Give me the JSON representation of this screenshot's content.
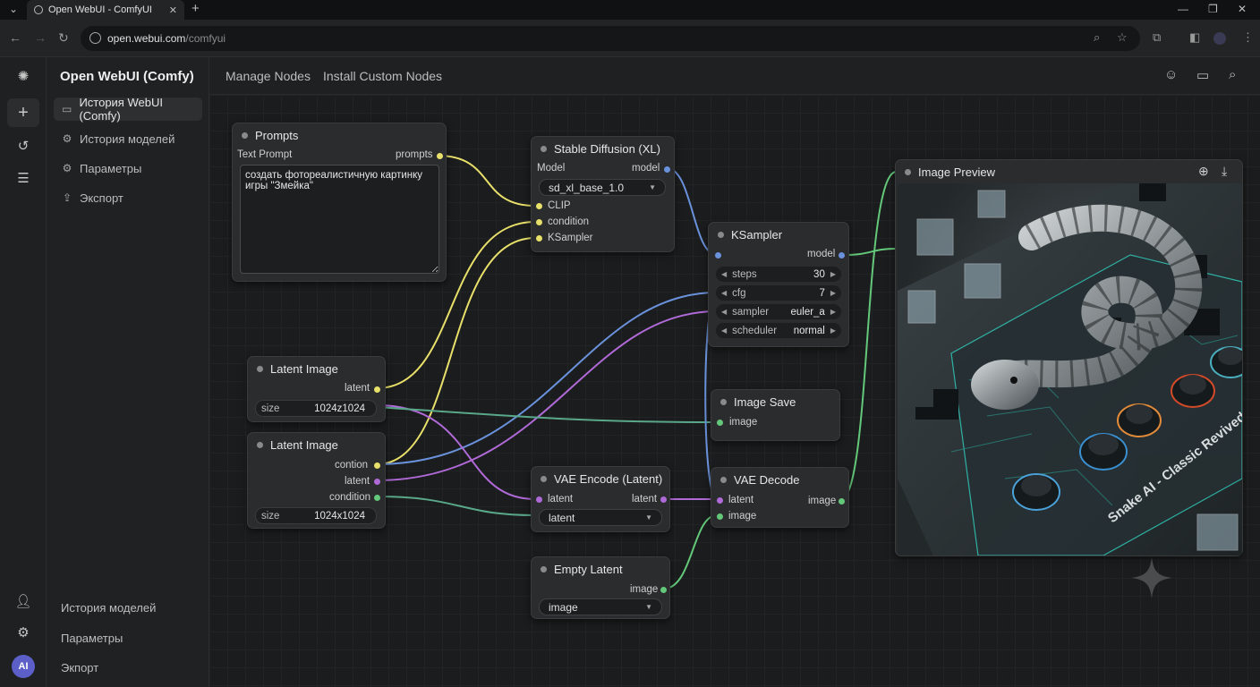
{
  "browser": {
    "tab_title": "Open WebUI - ComfyUI",
    "url_host": "open.webui.com",
    "url_path": "/comfyui"
  },
  "app": {
    "title": "Open WebUI (Comfy)"
  },
  "sidebar": {
    "items": [
      {
        "label": "История WebUI (Comfy)",
        "icon": "chat-bubble-icon"
      },
      {
        "label": "История моделей",
        "icon": "gear-icon"
      },
      {
        "label": "Параметры",
        "icon": "settings-icon"
      },
      {
        "label": "Экспорт",
        "icon": "export-icon"
      }
    ],
    "bottom_items": [
      "История моделей",
      "Параметры",
      "Экпорт"
    ]
  },
  "rail": {
    "avatar_text": "AI"
  },
  "topnav": {
    "manage": "Manage Nodes",
    "install": "Install Custom Nodes"
  },
  "nodes": {
    "prompts": {
      "title": "Prompts",
      "label": "Text Prompt",
      "output": "prompts",
      "text": "создать фотореалистичную картинку игры \"Змейка\""
    },
    "sd": {
      "title": "Stable Diffusion (XL)",
      "model_label": "Model",
      "model_output": "model",
      "model_value": "sd_xl_base_1.0",
      "inputs": [
        "CLIP",
        "condition",
        "KSampler"
      ]
    },
    "ksampler": {
      "title": "KSampler",
      "model_output": "model",
      "widgets": [
        {
          "name": "steps",
          "value": "30"
        },
        {
          "name": "cfg",
          "value": "7"
        },
        {
          "name": "sampler",
          "value": "euler_a"
        },
        {
          "name": "scheduler",
          "value": "normal"
        }
      ]
    },
    "latent1": {
      "title": "Latent Image",
      "output": "latent",
      "size_label": "size",
      "size_value": "1024z1024"
    },
    "latent2": {
      "title": "Latent Image",
      "outputs": [
        "contion",
        "latent",
        "condition"
      ],
      "size_label": "size",
      "size_value": "1024x1024"
    },
    "imagesave": {
      "title": "Image Save",
      "input": "image"
    },
    "vaeenc": {
      "title": "VAE Encode (Latent)",
      "input": "latent",
      "output": "latent",
      "select": "latent"
    },
    "vaedec": {
      "title": "VAE Decode",
      "inputs": [
        "latent",
        "image"
      ],
      "output": "image"
    },
    "emptylatent": {
      "title": "Empty Latent",
      "output": "image",
      "select": "image"
    },
    "preview": {
      "title": "Image Preview",
      "image_caption": "Snake AI - Classic Revived"
    }
  },
  "colors": {
    "clip_wire": "#e8e06a",
    "model_wire": "#6a92dc",
    "latent_wire": "#b06ad8",
    "image_wire": "#64c87a",
    "avatar": "#5b5fc7"
  }
}
